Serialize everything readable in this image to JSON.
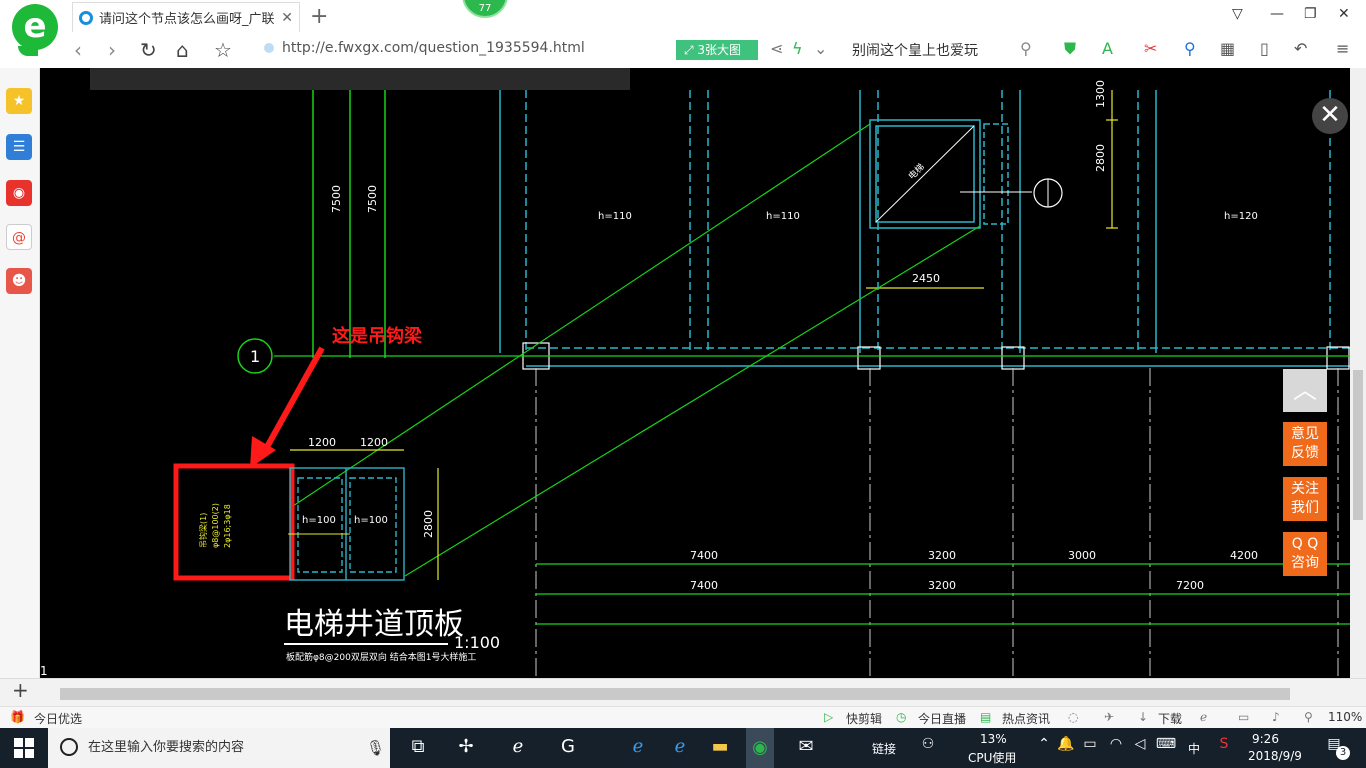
{
  "browser": {
    "tab_title": "请问这个节点该怎么画呀_广联达",
    "tab_close": "✕",
    "new_tab": "+",
    "badge": "77",
    "address": "http://e.fwxgx.com/question_1935594.html",
    "big_picture_label": "3张大图",
    "search_text": "别闹这个皇上也爱玩",
    "window_controls": [
      "▽",
      "—",
      "❐",
      "✕"
    ]
  },
  "drawing": {
    "annotation": "这是吊钩梁",
    "main_title": "电梯井道顶板",
    "scale": "1:100",
    "note": "板配筋φ8@200双层双向 结合本图1号大样施工",
    "axis_label": "1",
    "hook_text_1": "吊钩梁(1)",
    "hook_text_2": "φ8@100(2)",
    "hook_text_3": "2φ16;3φ18",
    "dims_small": {
      "top_left": "1200",
      "top_right": "1200",
      "height": "2800"
    },
    "slab_small_1": "h=100",
    "slab_small_2": "h=100",
    "dim_vertical_1": "7500",
    "dim_vertical_2": "7500",
    "slab_1": "h=110",
    "slab_2": "h=110",
    "slab_3": "h=120",
    "dim_2450": "2450",
    "dim_2800": "2800",
    "dim_1300": "1300",
    "shaft_label": "电梯",
    "dims_row1": [
      "7400",
      "3200",
      "3000",
      "4200"
    ],
    "dims_row2": [
      "7400",
      "3200",
      "7200"
    ]
  },
  "side_buttons": {
    "close": "✕",
    "totop": "︿",
    "feedback": "意见\n反馈",
    "follow": "关注\n我们",
    "qq": "Q Q\n咨询"
  },
  "page_number": "1",
  "status_bar": {
    "left": "今日优选",
    "items": [
      "快剪辑",
      "今日直播",
      "热点资讯",
      "下载"
    ],
    "zoom": "110%"
  },
  "taskbar": {
    "search_placeholder": "在这里输入你要搜索的内容",
    "link_label": "链接",
    "cpu_percent": "13%",
    "cpu_label": "CPU使用",
    "ime": "中",
    "time": "9:26",
    "date": "2018/9/9",
    "notif_count": "3"
  },
  "colors": {
    "cad_background": "#000000",
    "cad_green": "#19d219",
    "cad_cyan": "#2bb5c8",
    "cad_yellow": "#e8e82a",
    "annotation_red": "#ff1a1a",
    "side_orange": "#f06a1b"
  }
}
